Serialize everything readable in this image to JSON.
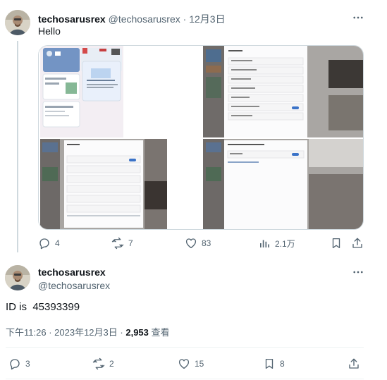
{
  "tweet1": {
    "display_name": "techosarusrex",
    "handle": "@techosarusrex",
    "separator": "·",
    "date": "12月3日",
    "text": "Hello",
    "actions": {
      "replies": "4",
      "retweets": "7",
      "likes": "83",
      "views": "2.1万"
    }
  },
  "tweet2": {
    "display_name": "techosarusrex",
    "handle": "@techosarusrex",
    "text": "ID is  45393399",
    "time": "下午11:26",
    "date": "2023年12月3日",
    "views_count": "2,953",
    "views_label": "查看",
    "actions": {
      "replies": "3",
      "retweets": "2",
      "likes": "15",
      "bookmarks": "8"
    }
  },
  "colors": {
    "text_primary": "#0f1419",
    "text_secondary": "#536471",
    "border": "#cfd9de",
    "thread_line": "#cfd9de"
  },
  "icons": [
    "more-icon",
    "reply-icon",
    "retweet-icon",
    "like-icon",
    "views-icon",
    "bookmark-icon",
    "share-icon"
  ]
}
